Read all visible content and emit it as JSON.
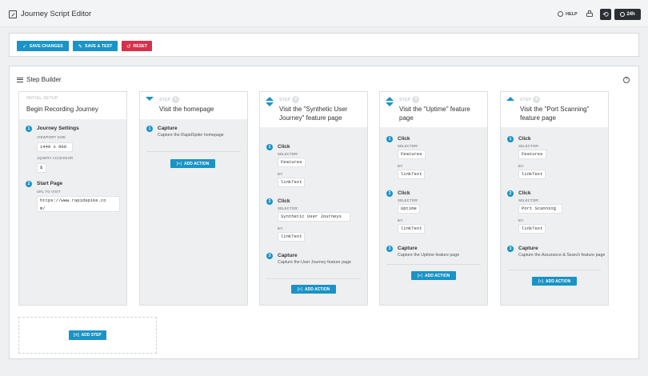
{
  "header": {
    "title": "Journey Script Editor",
    "help_label": "HELP",
    "time_range_label": "24h"
  },
  "toolbar": {
    "save_changes": "SAVE CHANGES",
    "save_and_test": "SAVE & TEST",
    "reset": "RESET"
  },
  "builder": {
    "title": "Step Builder",
    "add_step": "ADD STEP",
    "add_action": "ADD ACTION",
    "selector_label": "SELECTOR:",
    "by_label": "BY:"
  },
  "setup": {
    "label": "INITIAL SETUP",
    "title": "Begin Recording Journey",
    "journey_settings_title": "Journey Settings",
    "viewport_label": "VIEWPORT SIZE",
    "viewport_value": "1440 x 900",
    "jquery_label": "JQUERY ACCESSOR",
    "jquery_value": "$",
    "start_page_title": "Start Page",
    "url_label": "URL TO VISIT",
    "url_value_line1": "https://www.rapidspike.co",
    "url_value_line2": "m/"
  },
  "steps": [
    {
      "label": "STEP",
      "number": "1",
      "title": "Visit the homepage",
      "actions": [
        {
          "index": "1",
          "title": "Capture",
          "description": "Capture the RapidSpike homepage"
        }
      ]
    },
    {
      "label": "STEP",
      "number": "2",
      "title_line1": "Visit the \"Synthetic User",
      "title_line2": "Journey\" feature page",
      "actions": [
        {
          "index": "1",
          "title": "Click",
          "selector": "Features",
          "by": "linkText"
        },
        {
          "index": "2",
          "title": "Click",
          "selector": "Synthetic User Journeys",
          "by": "linkText"
        },
        {
          "index": "3",
          "title": "Capture",
          "description": "Capture the User Journey feature page"
        }
      ]
    },
    {
      "label": "STEP",
      "number": "3",
      "title_line1": "Visit the \"Uptime\" feature",
      "title_line2": "page",
      "actions": [
        {
          "index": "1",
          "title": "Click",
          "selector": "Features",
          "by": "linkText"
        },
        {
          "index": "2",
          "title": "Click",
          "selector": "Uptime",
          "by": "linkText"
        },
        {
          "index": "3",
          "title": "Capture",
          "description": "Capture the Uptime feature page"
        }
      ]
    },
    {
      "label": "STEP",
      "number": "4",
      "title_line1": "Visit the \"Port Scanning\"",
      "title_line2": "feature page",
      "actions": [
        {
          "index": "1",
          "title": "Click",
          "selector": "Features",
          "by": "linkText"
        },
        {
          "index": "2",
          "title": "Click",
          "selector": "Port Scanning",
          "by": "linkText"
        },
        {
          "index": "3",
          "title": "Capture",
          "description": "Capture the Assurance & Search feature page"
        }
      ]
    }
  ],
  "colors": {
    "accent": "#1a93c6",
    "danger": "#d6314b",
    "dark_button": "#2b2f33"
  }
}
